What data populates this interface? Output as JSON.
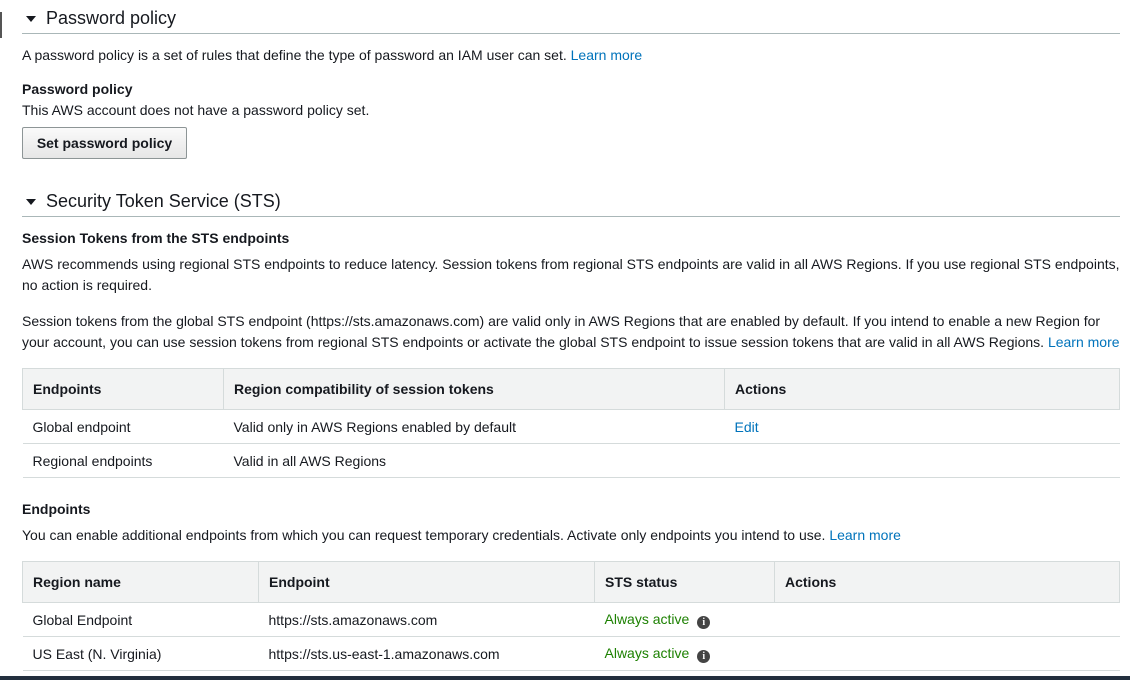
{
  "password_policy": {
    "title": "Password policy",
    "description": "A password policy is a set of rules that define the type of password an IAM user can set.",
    "learn_more": "Learn more",
    "subheading": "Password policy",
    "status_text": "This AWS account does not have a password policy set.",
    "button_label": "Set password policy"
  },
  "sts": {
    "title": "Security Token Service (STS)",
    "subheading": "Session Tokens from the STS endpoints",
    "paragraph1": "AWS recommends using regional STS endpoints to reduce latency. Session tokens from regional STS endpoints are valid in all AWS Regions. If you use regional STS endpoints, no action is required.",
    "paragraph2": "Session tokens from the global STS endpoint (https://sts.amazonaws.com) are valid only in AWS Regions that are enabled by default. If you intend to enable a new Region for your account, you can use session tokens from regional STS endpoints or activate the global STS endpoint to issue session tokens that are valid in all AWS Regions.",
    "learn_more": "Learn more",
    "token_table": {
      "headers": [
        "Endpoints",
        "Region compatibility of session tokens",
        "Actions"
      ],
      "rows": [
        {
          "endpoint": "Global endpoint",
          "compat": "Valid only in AWS Regions enabled by default",
          "action": "Edit"
        },
        {
          "endpoint": "Regional endpoints",
          "compat": "Valid in all AWS Regions",
          "action": ""
        }
      ]
    },
    "endpoints_heading": "Endpoints",
    "endpoints_description": "You can enable additional endpoints from which you can request temporary credentials. Activate only endpoints you intend to use.",
    "endpoints_learn_more": "Learn more",
    "endpoints_table": {
      "headers": [
        "Region name",
        "Endpoint",
        "STS status",
        "Actions"
      ],
      "rows": [
        {
          "region": "Global Endpoint",
          "endpoint": "https://sts.amazonaws.com",
          "status": "Always active",
          "action": ""
        },
        {
          "region": "US East (N. Virginia)",
          "endpoint": "https://sts.us-east-1.amazonaws.com",
          "status": "Always active",
          "action": ""
        }
      ]
    }
  },
  "colors": {
    "link": "#0073bb",
    "status_active": "#1d8102"
  },
  "icons": {
    "collapse": "caret-down-icon",
    "info": "info-icon"
  }
}
